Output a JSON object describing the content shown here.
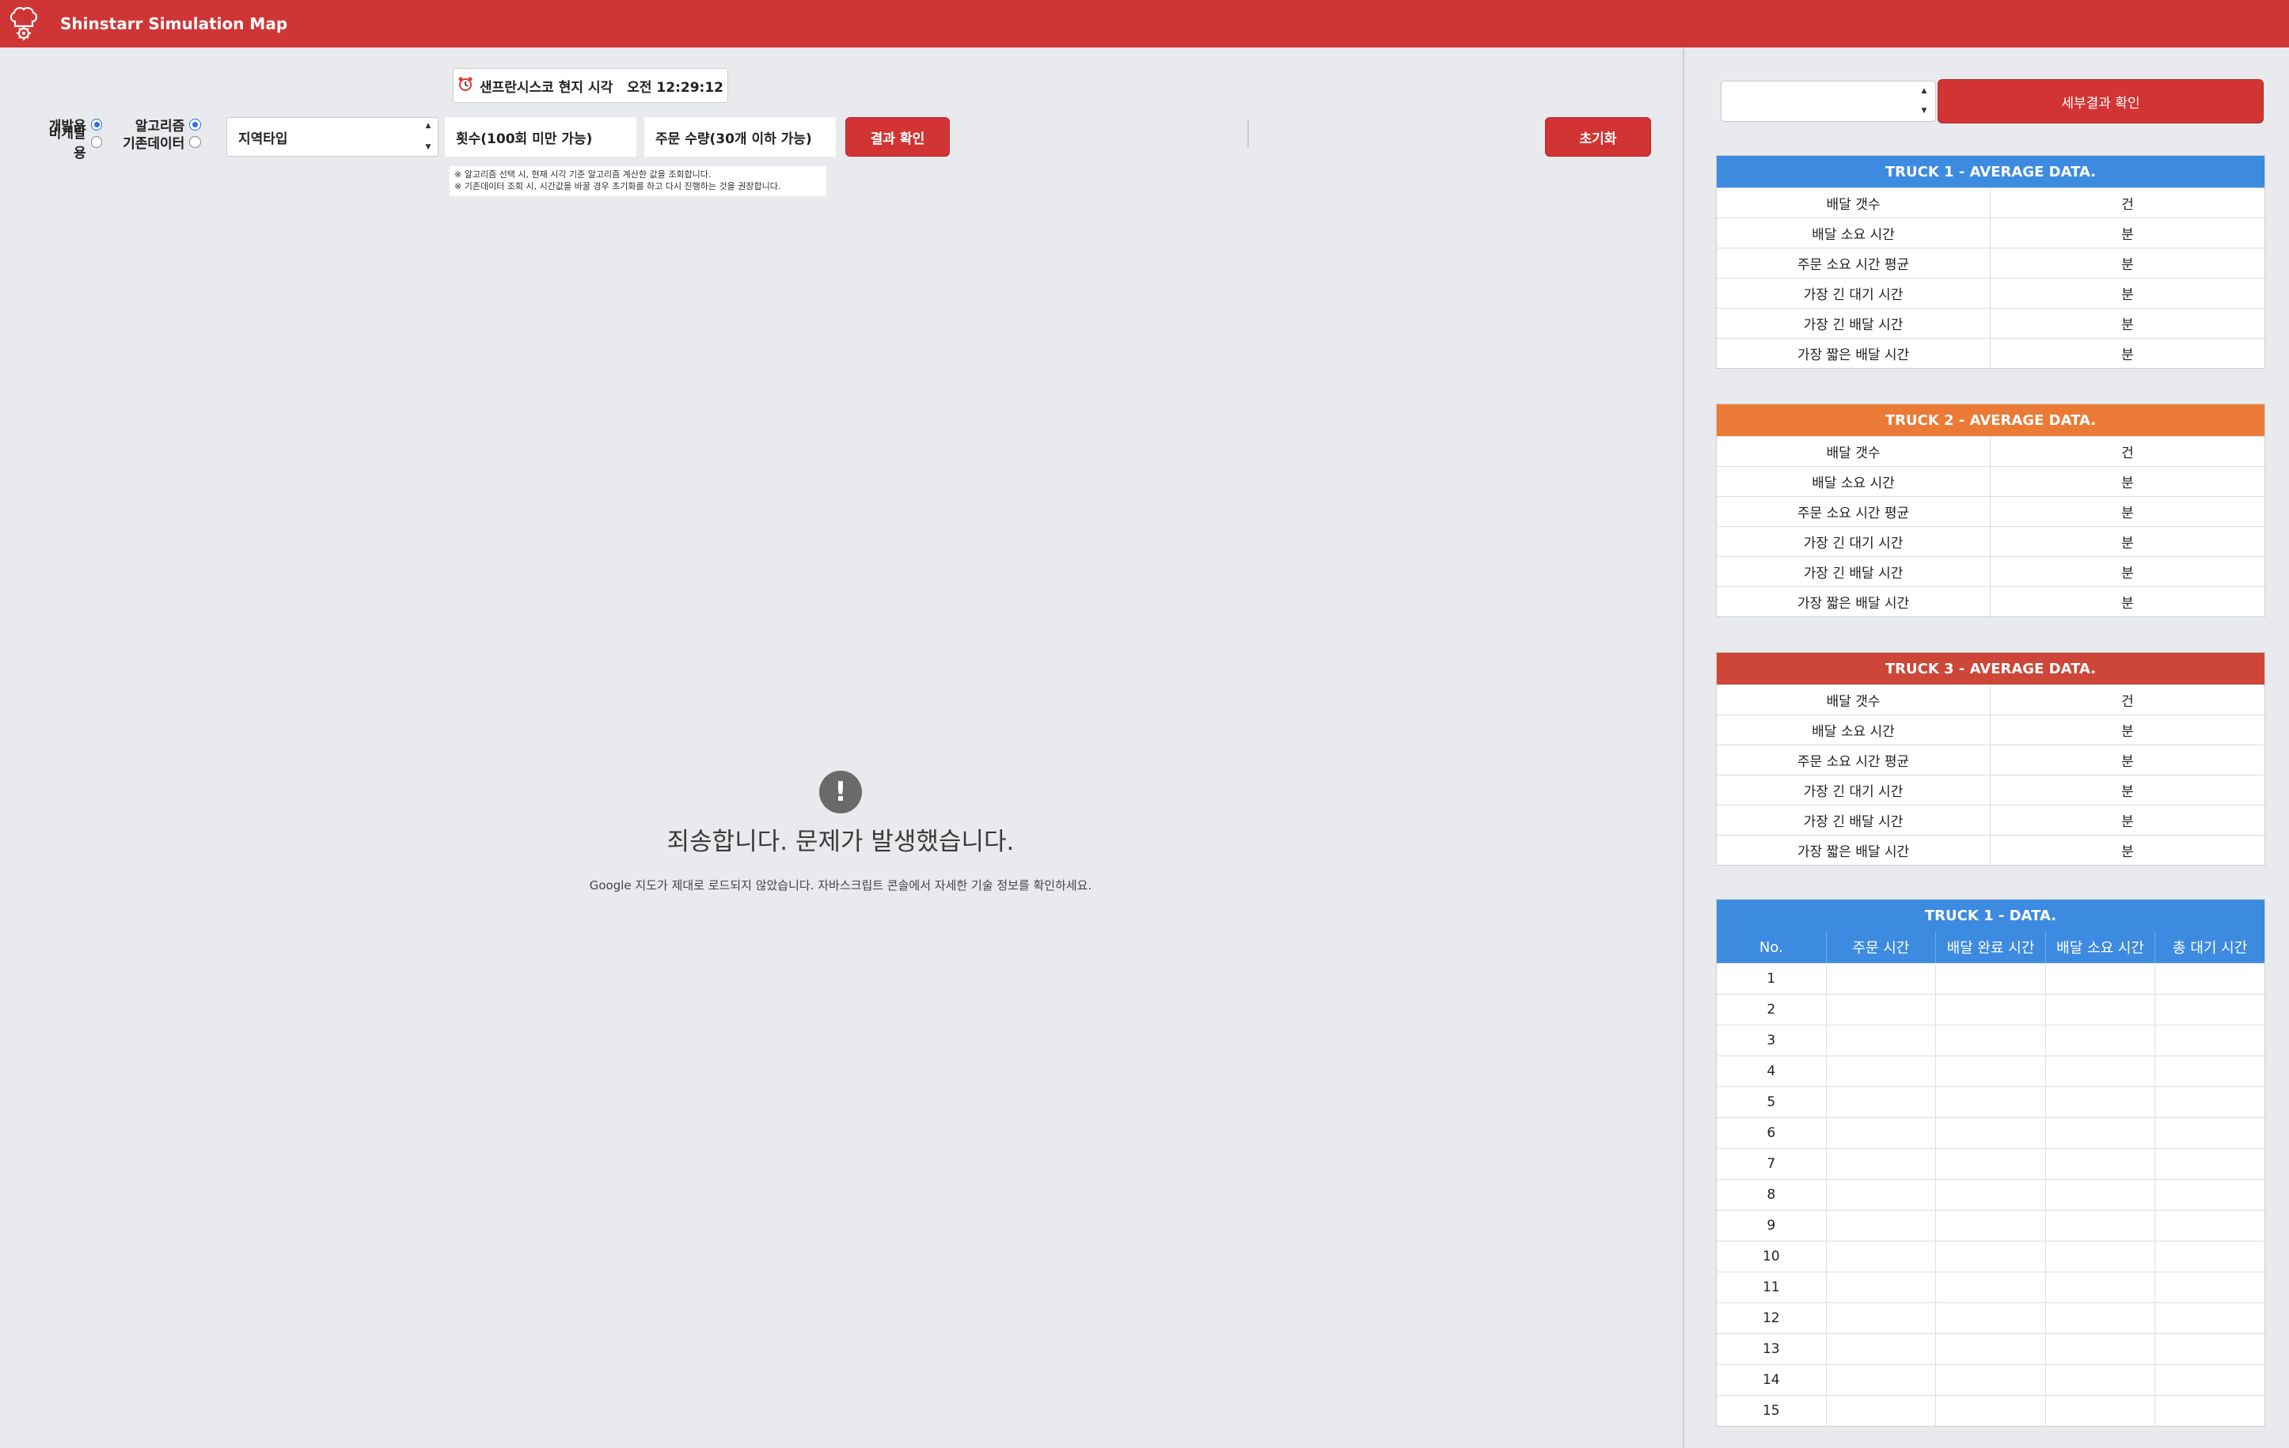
{
  "header": {
    "title": "Shinstarr Simulation Map",
    "logo_icon": "chef-hat-gear-icon",
    "color": "#cf3535"
  },
  "controls": {
    "clock_icon": "alarm-clock-icon",
    "clock_label": "샌프란시스코 현지 시각",
    "clock_time": "오전 12:29:12",
    "radios": {
      "dev_label": "개발용",
      "nondev_label": "비개발용",
      "algo_label": "알고리즘",
      "existing_label": "기존데이터"
    },
    "region_select": "지역타입",
    "count_placeholder": "횟수(100회 미만 가능)",
    "order_placeholder": "주문 수량(30개 이하 가능)",
    "result_button": "결과 확인",
    "reset_button": "초기화",
    "note1": "※ 알고리즘 선택 시, 현재 시각 기준 알고리즘 계산한 값을 조회합니다.",
    "note2": "※ 기존데이터 조회 시, 시간값을 바꿀 경우 초기화를 하고 다시 진행하는 것을 권장합니다."
  },
  "map_error": {
    "icon": "exclamation-icon",
    "title": "죄송합니다. 문제가 발생했습니다.",
    "message": "Google 지도가 제대로 로드되지 않았습니다. 자바스크립트 콘솔에서 자세한 기술 정보를 확인하세요."
  },
  "right_panel": {
    "detail_button": "세부결과 확인",
    "avg_tables": [
      {
        "title": "TRUCK 1 - AVERAGE DATA.",
        "color": "#3d8be0",
        "rows": [
          {
            "label": "배달 갯수",
            "unit": "건"
          },
          {
            "label": "배달 소요 시간",
            "unit": "분"
          },
          {
            "label": "주문 소요 시간 평균",
            "unit": "분"
          },
          {
            "label": "가장 긴 대기 시간",
            "unit": "분"
          },
          {
            "label": "가장 긴 배달 시간",
            "unit": "분"
          },
          {
            "label": "가장 짧은 배달 시간",
            "unit": "분"
          }
        ]
      },
      {
        "title": "TRUCK 2 - AVERAGE DATA.",
        "color": "#ea7a35",
        "rows": [
          {
            "label": "배달 갯수",
            "unit": "건"
          },
          {
            "label": "배달 소요 시간",
            "unit": "분"
          },
          {
            "label": "주문 소요 시간 평균",
            "unit": "분"
          },
          {
            "label": "가장 긴 대기 시간",
            "unit": "분"
          },
          {
            "label": "가장 긴 배달 시간",
            "unit": "분"
          },
          {
            "label": "가장 짧은 배달 시간",
            "unit": "분"
          }
        ]
      },
      {
        "title": "TRUCK 3 - AVERAGE DATA.",
        "color": "#cd4638",
        "rows": [
          {
            "label": "배달 갯수",
            "unit": "건"
          },
          {
            "label": "배달 소요 시간",
            "unit": "분"
          },
          {
            "label": "주문 소요 시간 평균",
            "unit": "분"
          },
          {
            "label": "가장 긴 대기 시간",
            "unit": "분"
          },
          {
            "label": "가장 긴 배달 시간",
            "unit": "분"
          },
          {
            "label": "가장 짧은 배달 시간",
            "unit": "분"
          }
        ]
      }
    ],
    "data_table": {
      "title": "TRUCK 1 - DATA.",
      "color": "#3d8be0",
      "columns": [
        "No.",
        "주문 시간",
        "배달 완료 시간",
        "배달 소요 시간",
        "총 대기 시간"
      ],
      "rows": [
        "1",
        "2",
        "3",
        "4",
        "5",
        "6",
        "7",
        "8",
        "9",
        "10",
        "11",
        "12",
        "13",
        "14",
        "15"
      ]
    }
  }
}
